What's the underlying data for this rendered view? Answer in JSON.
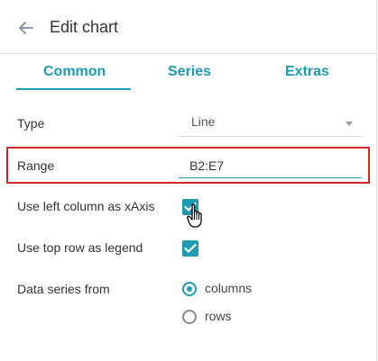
{
  "header": {
    "title": "Edit chart",
    "back_icon": "arrow-left-icon"
  },
  "tabs": [
    {
      "label": "Common",
      "active": true
    },
    {
      "label": "Series",
      "active": false
    },
    {
      "label": "Extras",
      "active": false
    }
  ],
  "form": {
    "type": {
      "label": "Type",
      "value": "Line"
    },
    "range": {
      "label": "Range",
      "value": "B2:E7"
    },
    "left_column": {
      "label": "Use left column as xAxis",
      "checked": true
    },
    "top_row": {
      "label": "Use top row as legend",
      "checked": true
    },
    "data_series": {
      "label": "Data series from",
      "options": [
        {
          "label": "columns",
          "selected": true
        },
        {
          "label": "rows",
          "selected": false
        }
      ]
    }
  },
  "colors": {
    "accent": "#1e9bb1",
    "highlight": "#d7262b"
  }
}
